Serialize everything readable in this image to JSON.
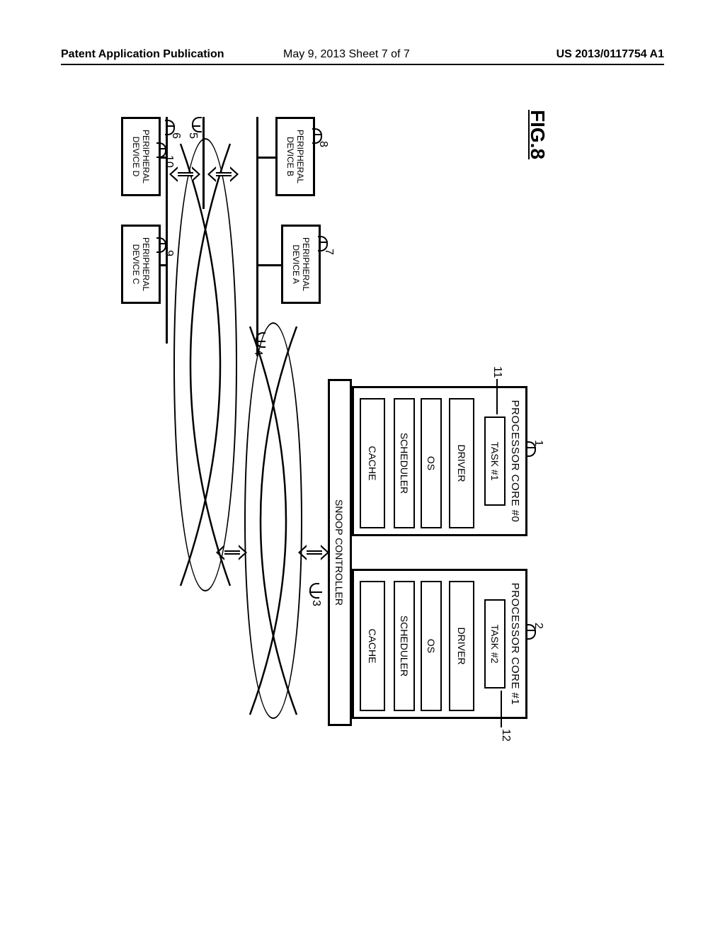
{
  "header": {
    "left": "Patent Application Publication",
    "mid": "May 9, 2013  Sheet 7 of 7",
    "right": "US 2013/0117754 A1"
  },
  "figure": {
    "title": "FIG.8",
    "core0": {
      "title": "PROCESSOR CORE #0",
      "task": "TASK #1",
      "driver": "DRIVER",
      "os": "OS",
      "scheduler": "SCHEDULER",
      "cache": "CACHE",
      "ref": "1",
      "taskref": "11"
    },
    "core1": {
      "title": "PROCESSOR CORE #1",
      "task": "TASK #2",
      "driver": "DRIVER",
      "os": "OS",
      "scheduler": "SCHEDULER",
      "cache": "CACHE",
      "ref": "2",
      "taskref": "12"
    },
    "snoop": {
      "label": "SNOOP CONTROLLER",
      "ref": "3"
    },
    "bus": {
      "upper_ref": "4",
      "mid_ref": "5",
      "lower_ref": "6"
    },
    "periph": {
      "a": {
        "label": "PERIPHERAL\nDEVICE A",
        "ref": "7"
      },
      "b": {
        "label": "PERIPHERAL\nDEVICE B",
        "ref": "8"
      },
      "c": {
        "label": "PERIPHERAL\nDEVICE C",
        "ref": "9"
      },
      "d": {
        "label": "PERIPHERAL\nDEVICE D",
        "ref": "10"
      }
    }
  }
}
